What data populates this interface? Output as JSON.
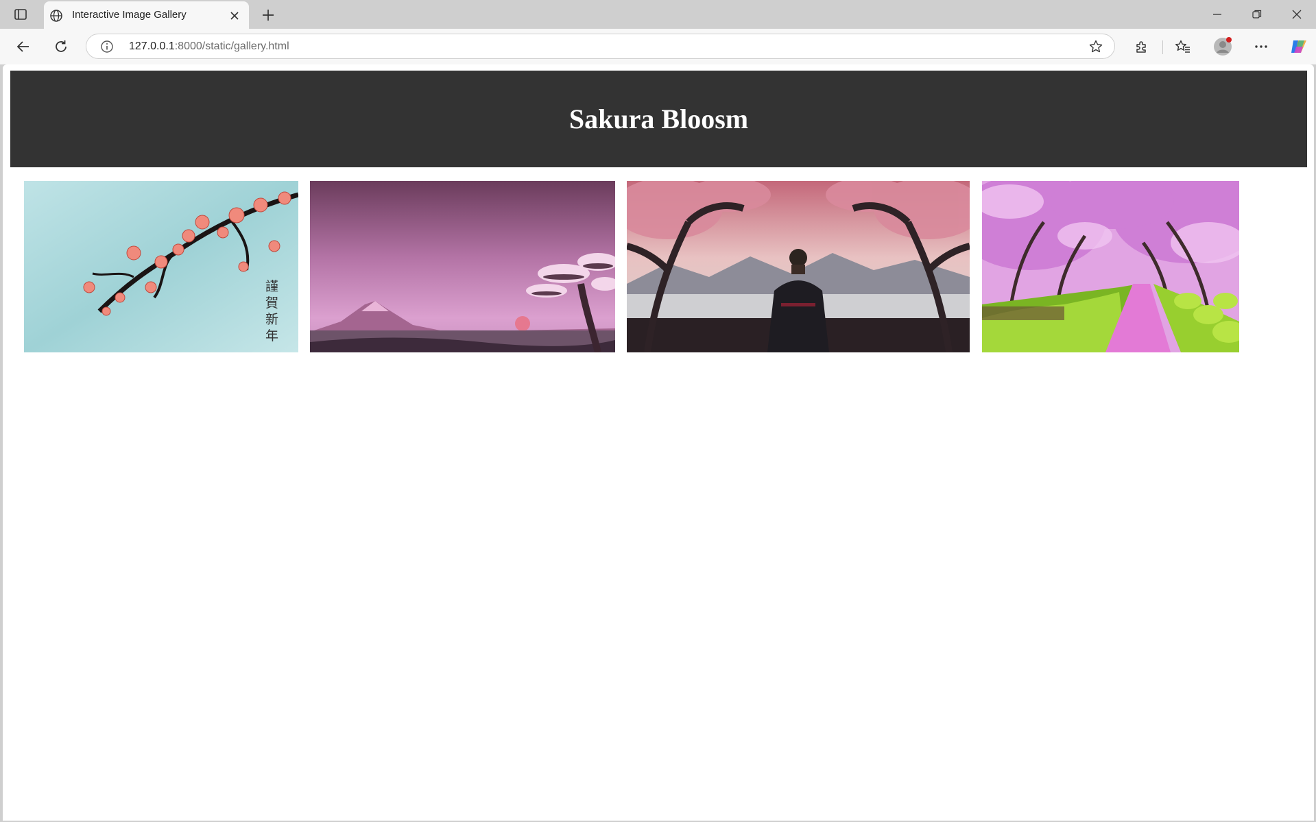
{
  "browser": {
    "tab_title": "Interactive Image Gallery",
    "url_host": "127.0.0.1",
    "url_rest": ":8000/static/gallery.html",
    "icons": [
      "tab-actions-icon",
      "globe-icon",
      "close-icon",
      "new-tab-icon",
      "minimize-icon",
      "restore-icon",
      "window-close-icon",
      "back-icon",
      "reload-icon",
      "info-icon",
      "star-icon",
      "extensions-icon",
      "favorites-icon",
      "profile-icon",
      "more-icon",
      "copilot-icon"
    ]
  },
  "page": {
    "title": "Sakura Bloosm",
    "header_bg": "#333333",
    "gallery": [
      {
        "name": "plum-blossom-new-year",
        "calligraphy": "謹賀新年"
      },
      {
        "name": "mount-fuji-sunset"
      },
      {
        "name": "samurai-under-cherry-trees"
      },
      {
        "name": "cherry-blossom-path"
      }
    ]
  }
}
